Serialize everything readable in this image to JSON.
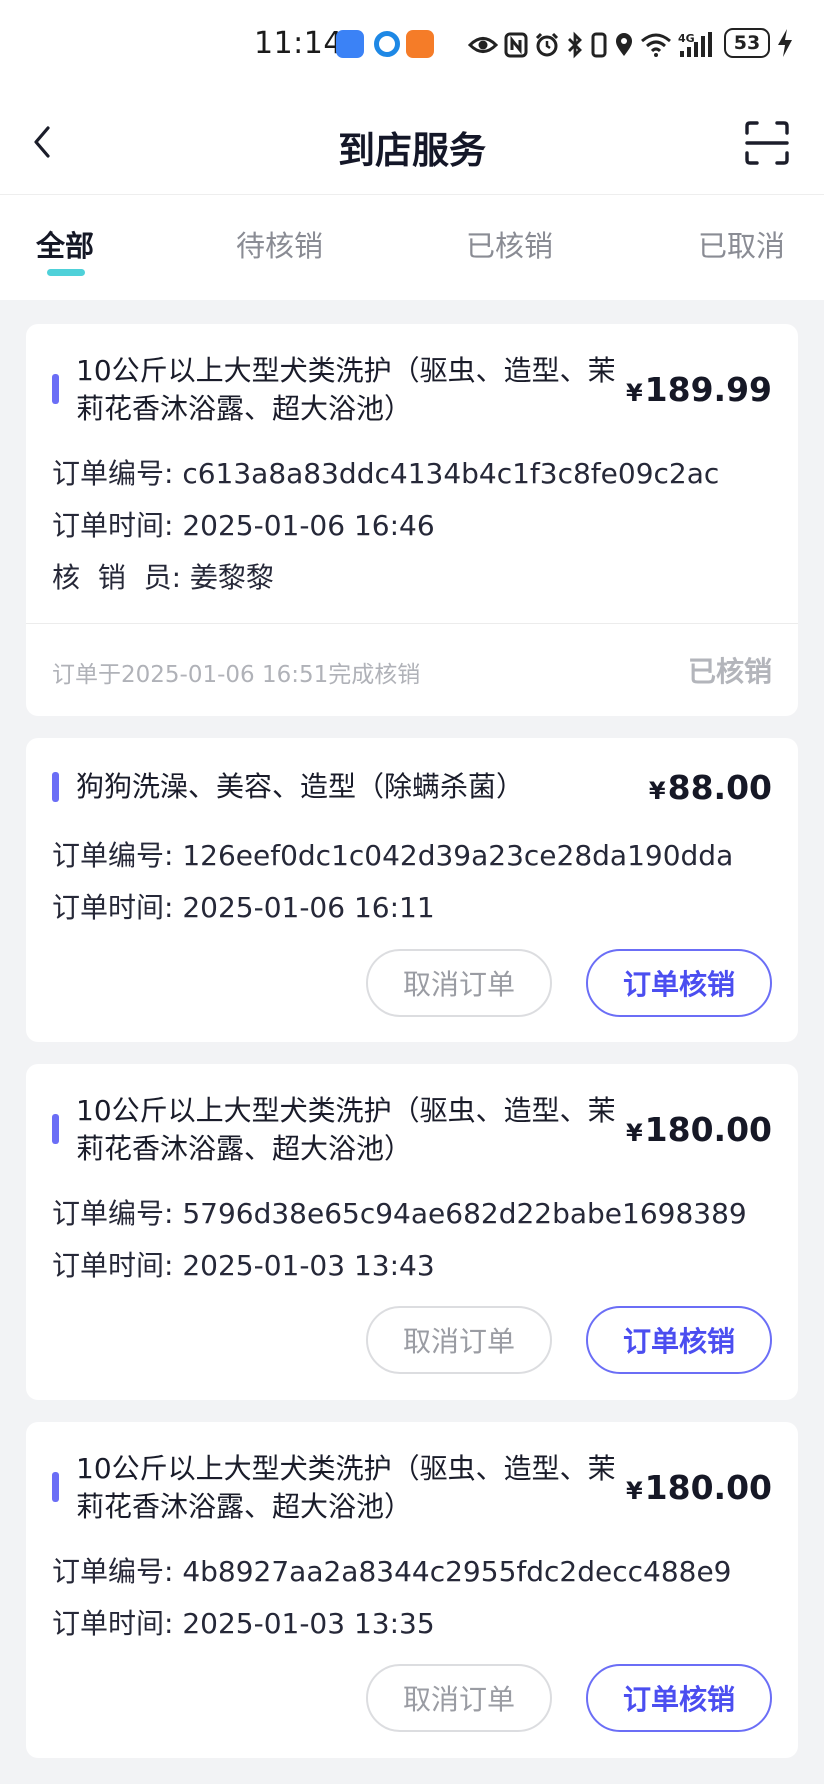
{
  "status_bar": {
    "time": "11:14",
    "battery": "53",
    "icons": [
      "usb-app-icon",
      "browser-app-icon",
      "shop-app-icon",
      "eye-icon",
      "nfc-icon",
      "alarm-icon",
      "bluetooth-icon",
      "vibrate-icon",
      "location-icon",
      "wifi-icon",
      "signal-4g-icon",
      "battery-icon",
      "charging-icon"
    ]
  },
  "header": {
    "title": "到店服务"
  },
  "tabs": [
    {
      "label": "全部"
    },
    {
      "label": "待核销"
    },
    {
      "label": "已核销"
    },
    {
      "label": "已取消"
    }
  ],
  "orders": [
    {
      "title": "10公斤以上大型犬类洗护（驱虫、造型、茉莉花香沐浴露、超大浴池）",
      "price_symbol": "¥",
      "price": "189.99",
      "order_no": "订单编号: c613a8a83ddc4134b4c1f3c8fe09c2ac",
      "order_time": "订单时间: 2025-01-06 16:46",
      "verifier": "核  销  员: 姜黎黎",
      "done_note": "订单于2025-01-06 16:51完成核销",
      "status": "已核销"
    },
    {
      "title": "狗狗洗澡、美容、造型（除螨杀菌）",
      "price_symbol": "¥",
      "price": "88.00",
      "order_no": "订单编号: 126eef0dc1c042d39a23ce28da190dda",
      "order_time": "订单时间: 2025-01-06 16:11",
      "cancel_label": "取消订单",
      "verify_label": "订单核销"
    },
    {
      "title": "10公斤以上大型犬类洗护（驱虫、造型、茉莉花香沐浴露、超大浴池）",
      "price_symbol": "¥",
      "price": "180.00",
      "order_no": "订单编号: 5796d38e65c94ae682d22babe1698389",
      "order_time": "订单时间: 2025-01-03 13:43",
      "cancel_label": "取消订单",
      "verify_label": "订单核销"
    },
    {
      "title": "10公斤以上大型犬类洗护（驱虫、造型、茉莉花香沐浴露、超大浴池）",
      "price_symbol": "¥",
      "price": "180.00",
      "order_no": "订单编号: 4b8927aa2a8344c2955fdc2decc488e9",
      "order_time": "订单时间: 2025-01-03 13:35",
      "cancel_label": "取消订单",
      "verify_label": "订单核销"
    }
  ],
  "colors": {
    "accent": "#6b6ef6",
    "tab_indicator": "#4fd1d9",
    "background": "#f2f3f5"
  }
}
